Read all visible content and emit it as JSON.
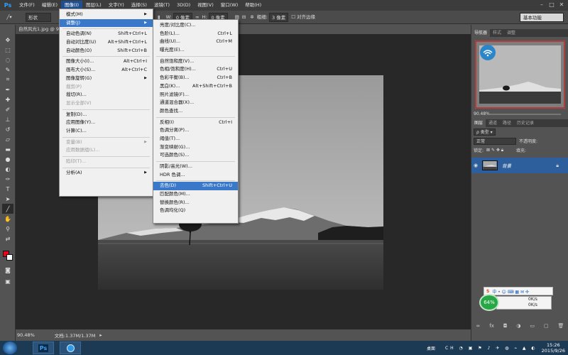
{
  "menubar": {
    "logo": "Ps",
    "items": [
      "文件(F)",
      "编辑(E)",
      "图像(I)",
      "图层(L)",
      "文字(Y)",
      "选择(S)",
      "滤镜(T)",
      "3D(D)",
      "视图(V)",
      "窗口(W)",
      "帮助(H)"
    ],
    "active_index": 2
  },
  "options_bar": {
    "shape_mode": "形状",
    "w_label": "W:",
    "w_value": "0 像素",
    "h_label": "H:",
    "h_value": "0 像素",
    "weight_label": "粗细:",
    "weight_value": "3 像素",
    "align_edges": "对齐边缘",
    "workspace": "基本功能"
  },
  "document": {
    "tab_title": "自然风光1.jpg @ 9",
    "zoom": "90.48%",
    "doc_info": "文档:1.37M/1.37M"
  },
  "image_menu": {
    "items": [
      {
        "label": "模式(M)",
        "shortcut": "",
        "submenu": true,
        "disabled": false
      },
      {
        "label": "调整(J)",
        "shortcut": "",
        "submenu": true,
        "disabled": false,
        "highlight": true
      },
      {
        "sep": true
      },
      {
        "label": "自动色调(N)",
        "shortcut": "Shift+Ctrl+L",
        "disabled": false
      },
      {
        "label": "自动对比度(U)",
        "shortcut": "Alt+Shift+Ctrl+L",
        "disabled": false
      },
      {
        "label": "自动颜色(O)",
        "shortcut": "Shift+Ctrl+B",
        "disabled": false
      },
      {
        "sep": true
      },
      {
        "label": "图像大小(I)...",
        "shortcut": "Alt+Ctrl+I",
        "disabled": false
      },
      {
        "label": "画布大小(S)...",
        "shortcut": "Alt+Ctrl+C",
        "disabled": false
      },
      {
        "label": "图像旋转(G)",
        "shortcut": "",
        "submenu": true,
        "disabled": false
      },
      {
        "label": "裁剪(P)",
        "shortcut": "",
        "disabled": true
      },
      {
        "label": "裁切(R)...",
        "shortcut": "",
        "disabled": false
      },
      {
        "label": "显示全部(V)",
        "shortcut": "",
        "disabled": true
      },
      {
        "sep": true
      },
      {
        "label": "复制(D)...",
        "shortcut": "",
        "disabled": false
      },
      {
        "label": "应用图像(Y)...",
        "shortcut": "",
        "disabled": false
      },
      {
        "label": "计算(C)...",
        "shortcut": "",
        "disabled": false
      },
      {
        "sep": true
      },
      {
        "label": "变量(B)",
        "shortcut": "",
        "submenu": true,
        "disabled": true
      },
      {
        "label": "应用数据组(L)...",
        "shortcut": "",
        "disabled": true
      },
      {
        "sep": true
      },
      {
        "label": "陷印(T)...",
        "shortcut": "",
        "disabled": true
      },
      {
        "sep": true
      },
      {
        "label": "分析(A)",
        "shortcut": "",
        "submenu": true,
        "disabled": false
      }
    ]
  },
  "adjust_menu": {
    "items": [
      {
        "label": "亮度/对比度(C)...",
        "shortcut": ""
      },
      {
        "label": "色阶(L)...",
        "shortcut": "Ctrl+L"
      },
      {
        "label": "曲线(U)...",
        "shortcut": "Ctrl+M"
      },
      {
        "label": "曝光度(E)...",
        "shortcut": ""
      },
      {
        "sep": true
      },
      {
        "label": "自然饱和度(V)...",
        "shortcut": ""
      },
      {
        "label": "色相/饱和度(H)...",
        "shortcut": "Ctrl+U"
      },
      {
        "label": "色彩平衡(B)...",
        "shortcut": "Ctrl+B"
      },
      {
        "label": "黑白(K)...",
        "shortcut": "Alt+Shift+Ctrl+B"
      },
      {
        "label": "照片滤镜(F)...",
        "shortcut": ""
      },
      {
        "label": "通道混合器(X)...",
        "shortcut": ""
      },
      {
        "label": "颜色查找...",
        "shortcut": ""
      },
      {
        "sep": true
      },
      {
        "label": "反相(I)",
        "shortcut": "Ctrl+I"
      },
      {
        "label": "色调分离(P)...",
        "shortcut": ""
      },
      {
        "label": "阈值(T)...",
        "shortcut": ""
      },
      {
        "label": "渐变映射(G)...",
        "shortcut": ""
      },
      {
        "label": "可选颜色(S)...",
        "shortcut": ""
      },
      {
        "sep": true
      },
      {
        "label": "阴影/高光(W)...",
        "shortcut": ""
      },
      {
        "label": "HDR 色调...",
        "shortcut": ""
      },
      {
        "sep": true
      },
      {
        "label": "去色(D)",
        "shortcut": "Shift+Ctrl+U",
        "highlight": true
      },
      {
        "label": "匹配颜色(M)...",
        "shortcut": ""
      },
      {
        "label": "替换颜色(R)...",
        "shortcut": ""
      },
      {
        "label": "色调均化(Q)",
        "shortcut": ""
      }
    ]
  },
  "navigator": {
    "tabs": [
      "导航器",
      "样式",
      "调整"
    ],
    "zoom": "90.48%"
  },
  "layers_panel": {
    "tabs": [
      "图层",
      "通道",
      "路径",
      "历史记录"
    ],
    "filter_kind": "类型",
    "blend_mode": "正常",
    "opacity_label": "不透明度:",
    "lock_label": "锁定:",
    "fill_label": "填充:",
    "layer_name": "背景"
  },
  "widget": {
    "cpu": "64%",
    "up": "0K/s",
    "down": "0K/s"
  },
  "taskbar": {
    "desktop_label": "桌面",
    "time": "15:26",
    "date": "2015/9/26"
  },
  "colors": {
    "foreground": "#e8001c",
    "background": "#ffffff",
    "menu_highlight": "#3a78c9"
  }
}
